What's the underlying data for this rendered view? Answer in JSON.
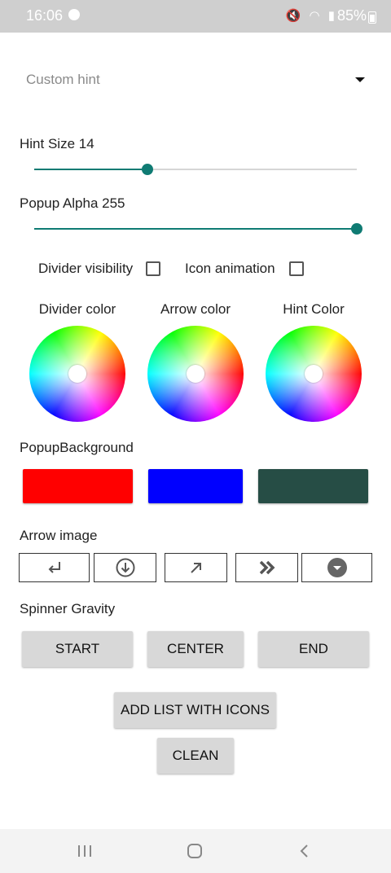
{
  "status_bar": {
    "time": "16:06",
    "battery": "85%"
  },
  "spinner": {
    "hint": "Custom hint"
  },
  "hint_size": {
    "label": "Hint Size 14",
    "value": 14,
    "max": 40
  },
  "popup_alpha": {
    "label": "Popup Alpha 255",
    "value": 255,
    "max": 255
  },
  "checkboxes": {
    "divider_visibility": {
      "label": "Divider visibility",
      "checked": false
    },
    "icon_animation": {
      "label": "Icon animation",
      "checked": false
    }
  },
  "color_pickers": [
    {
      "label": "Divider color"
    },
    {
      "label": "Arrow color"
    },
    {
      "label": "Hint Color"
    }
  ],
  "popup_background": {
    "label": "PopupBackground",
    "colors": [
      "#ff0000",
      "#0000ff",
      "#264d45"
    ]
  },
  "arrow_image": {
    "label": "Arrow image",
    "options": [
      "return-arrow-icon",
      "circle-down-arrow-icon",
      "up-right-arrow-icon",
      "double-chevron-right-icon",
      "filled-circle-caret-down-icon"
    ]
  },
  "spinner_gravity": {
    "label": "Spinner Gravity",
    "buttons": [
      "START",
      "CENTER",
      "END"
    ]
  },
  "actions": {
    "add_list": "ADD LIST WITH ICONS",
    "clean": "CLEAN"
  }
}
